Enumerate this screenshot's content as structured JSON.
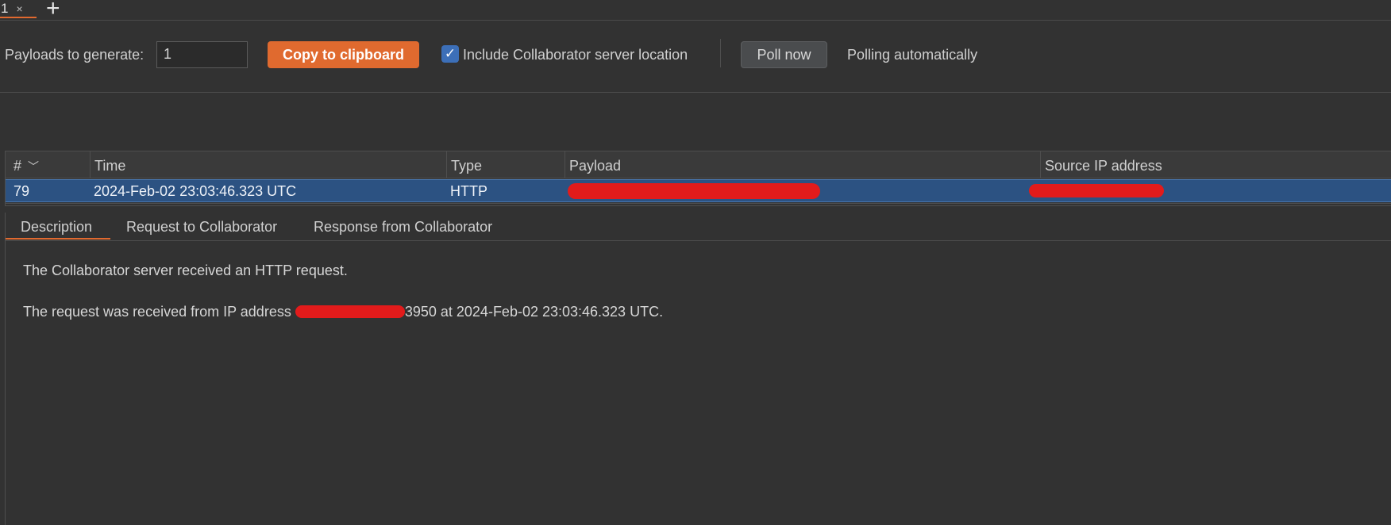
{
  "tabs": [
    {
      "label": "1",
      "close": "×"
    }
  ],
  "tab_add_label": "+",
  "toolbar": {
    "payloads_label": "Payloads to generate:",
    "payloads_value": "1",
    "copy_label": "Copy to clipboard",
    "include_checked": true,
    "include_label": "Include Collaborator server location",
    "poll_label": "Poll now",
    "polling_status": "Polling automatically"
  },
  "table": {
    "columns": [
      "#",
      "Time",
      "Type",
      "Payload",
      "Source IP address"
    ],
    "rows": [
      {
        "num": "79",
        "time": "2024-Feb-02 23:03:46.323 UTC",
        "type": "HTTP",
        "payload": "[redacted]",
        "source_ip": "[redacted]"
      }
    ]
  },
  "detail": {
    "tabs": [
      "Description",
      "Request to Collaborator",
      "Response from Collaborator"
    ],
    "active_tab": "Description",
    "line1": "The Collaborator server received an HTTP request.",
    "line2_prefix": "The request was received from IP address",
    "line2_suffix": "3950 at 2024-Feb-02 23:03:46.323 UTC."
  },
  "colors": {
    "accent": "#e06a2f",
    "selection": "#2c5282",
    "checkbox": "#3c6fb8",
    "redaction": "#e21b1b",
    "background": "#323232"
  }
}
